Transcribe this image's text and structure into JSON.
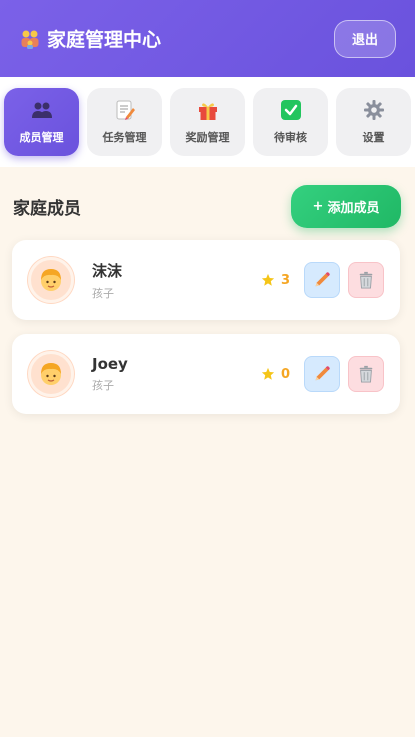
{
  "header": {
    "brand_icon": "family-icon",
    "title": "家庭管理中心",
    "logout_label": "退出"
  },
  "nav": {
    "items": [
      {
        "label": "成员管理",
        "icon": "people-icon",
        "active": true
      },
      {
        "label": "任务管理",
        "icon": "memo-icon",
        "active": false
      },
      {
        "label": "奖励管理",
        "icon": "gift-icon",
        "active": false
      },
      {
        "label": "待审核",
        "icon": "check-icon",
        "active": false
      },
      {
        "label": "设置",
        "icon": "gear-icon",
        "active": false
      }
    ]
  },
  "section": {
    "title": "家庭成员",
    "add_label": "添加成员",
    "add_prefix": "+"
  },
  "members": [
    {
      "name": "沫沫",
      "role": "孩子",
      "points": "3",
      "avatar": "child-icon"
    },
    {
      "name": "Joey",
      "role": "孩子",
      "points": "0",
      "avatar": "child-icon"
    }
  ],
  "colors": {
    "primary": "#6a52dd",
    "success": "#20b865",
    "background": "#fdf6ec",
    "star": "#f5c518"
  }
}
